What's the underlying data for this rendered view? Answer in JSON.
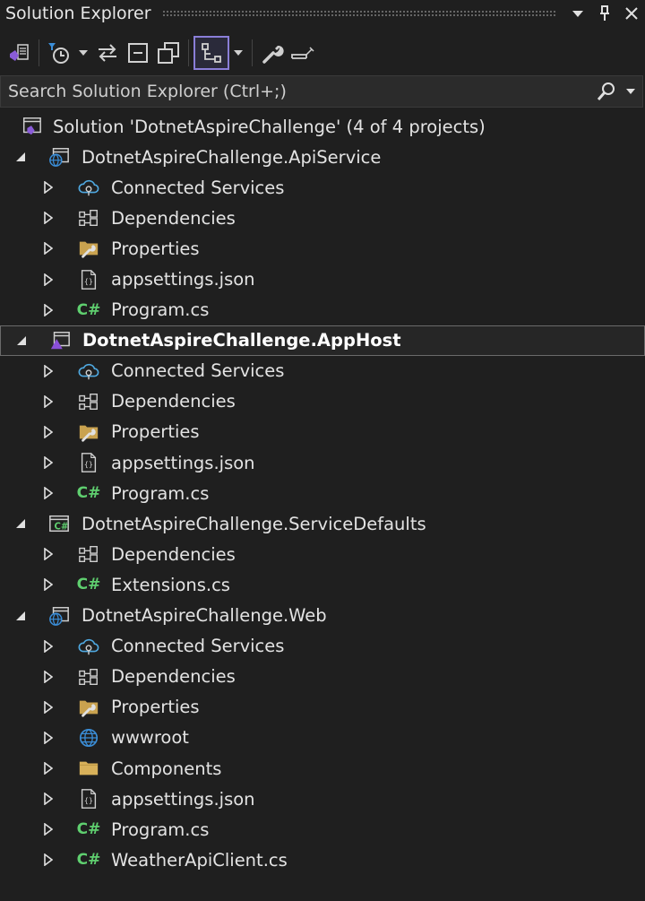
{
  "panel": {
    "title": "Solution Explorer"
  },
  "search": {
    "placeholder": "Search Solution Explorer (Ctrl+;)"
  },
  "tree": [
    {
      "label": "Solution 'DotnetAspireChallenge' (4 of 4 projects)",
      "icon": "solution-icon",
      "level": 0,
      "expander": "none"
    },
    {
      "label": "DotnetAspireChallenge.ApiService",
      "icon": "web-project-icon",
      "level": 1,
      "expander": "expanded"
    },
    {
      "label": "Connected Services",
      "icon": "connected-services-icon",
      "level": 2,
      "expander": "collapsed"
    },
    {
      "label": "Dependencies",
      "icon": "dependencies-icon",
      "level": 2,
      "expander": "collapsed"
    },
    {
      "label": "Properties",
      "icon": "properties-folder-icon",
      "level": 2,
      "expander": "collapsed"
    },
    {
      "label": "appsettings.json",
      "icon": "json-file-icon",
      "level": 2,
      "expander": "collapsed"
    },
    {
      "label": "Program.cs",
      "icon": "csharp-file-icon",
      "level": 2,
      "expander": "collapsed"
    },
    {
      "label": "DotnetAspireChallenge.AppHost",
      "icon": "apphost-project-icon",
      "level": 1,
      "expander": "expanded",
      "selected": true,
      "bold": true
    },
    {
      "label": "Connected Services",
      "icon": "connected-services-icon",
      "level": 2,
      "expander": "collapsed"
    },
    {
      "label": "Dependencies",
      "icon": "dependencies-icon",
      "level": 2,
      "expander": "collapsed"
    },
    {
      "label": "Properties",
      "icon": "properties-folder-icon",
      "level": 2,
      "expander": "collapsed"
    },
    {
      "label": "appsettings.json",
      "icon": "json-file-icon",
      "level": 2,
      "expander": "collapsed"
    },
    {
      "label": "Program.cs",
      "icon": "csharp-file-icon",
      "level": 2,
      "expander": "collapsed"
    },
    {
      "label": "DotnetAspireChallenge.ServiceDefaults",
      "icon": "csharp-project-icon",
      "level": 1,
      "expander": "expanded"
    },
    {
      "label": "Dependencies",
      "icon": "dependencies-icon",
      "level": 2,
      "expander": "collapsed"
    },
    {
      "label": "Extensions.cs",
      "icon": "csharp-file-icon",
      "level": 2,
      "expander": "collapsed"
    },
    {
      "label": "DotnetAspireChallenge.Web",
      "icon": "web-project-icon",
      "level": 1,
      "expander": "expanded"
    },
    {
      "label": "Connected Services",
      "icon": "connected-services-icon",
      "level": 2,
      "expander": "collapsed"
    },
    {
      "label": "Dependencies",
      "icon": "dependencies-icon",
      "level": 2,
      "expander": "collapsed"
    },
    {
      "label": "Properties",
      "icon": "properties-folder-icon",
      "level": 2,
      "expander": "collapsed"
    },
    {
      "label": "wwwroot",
      "icon": "globe-icon",
      "level": 2,
      "expander": "collapsed"
    },
    {
      "label": "Components",
      "icon": "folder-icon",
      "level": 2,
      "expander": "collapsed"
    },
    {
      "label": "appsettings.json",
      "icon": "json-file-icon",
      "level": 2,
      "expander": "collapsed"
    },
    {
      "label": "Program.cs",
      "icon": "csharp-file-icon",
      "level": 2,
      "expander": "collapsed"
    },
    {
      "label": "WeatherApiClient.cs",
      "icon": "csharp-file-icon",
      "level": 2,
      "expander": "collapsed"
    }
  ],
  "colors": {
    "background": "#1f1f1f",
    "text": "#e3e3e3",
    "accent": "#8a7ed8",
    "csharp": "#5fcf6f",
    "folder": "#d8b15a",
    "globe": "#3b8ed8"
  }
}
